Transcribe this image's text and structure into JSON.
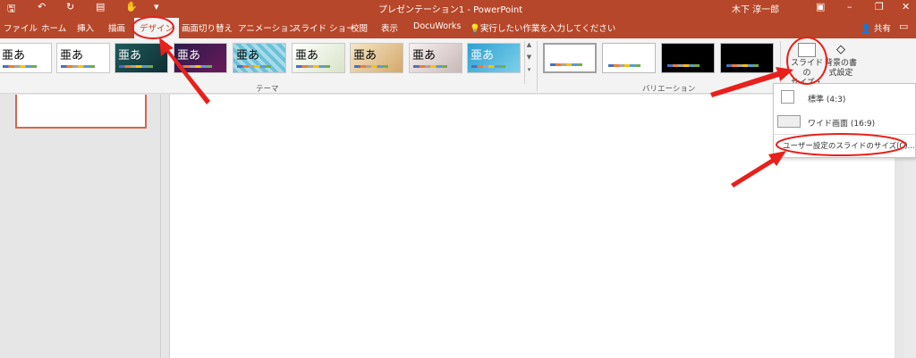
{
  "titlebar": {
    "title": "プレゼンテーション1  -  PowerPoint",
    "user": "木下 淳一郎",
    "qat": [
      "save-icon",
      "undo-icon",
      "redo-icon",
      "present-icon",
      "touch-icon",
      "customize-icon"
    ]
  },
  "tabs": [
    "ファイル",
    "ホーム",
    "挿入",
    "描画",
    "デザイン",
    "画面切り替え",
    "アニメーション",
    "スライド ショー",
    "校閲",
    "表示",
    "DocuWorks"
  ],
  "active_tab": "デザイン",
  "tell_me": "実行したい作業を入力してください",
  "share": "共有",
  "ribbon": {
    "themes_label": "テーマ",
    "variants_label": "バリエーション",
    "theme_sample_text": "亜あ",
    "slide_size_label_1": "スライドの",
    "slide_size_label_2": "サイズ・",
    "background_label_1": "背景の書",
    "background_label_2": "式設定"
  },
  "dropdown": {
    "standard": "標準 (4:3)",
    "widescreen": "ワイド画面 (16:9)",
    "custom": "ユーザー設定のスライドのサイズ(C)..."
  },
  "colors": {
    "accent": "#b7472a",
    "annotation": "#e8201b"
  }
}
